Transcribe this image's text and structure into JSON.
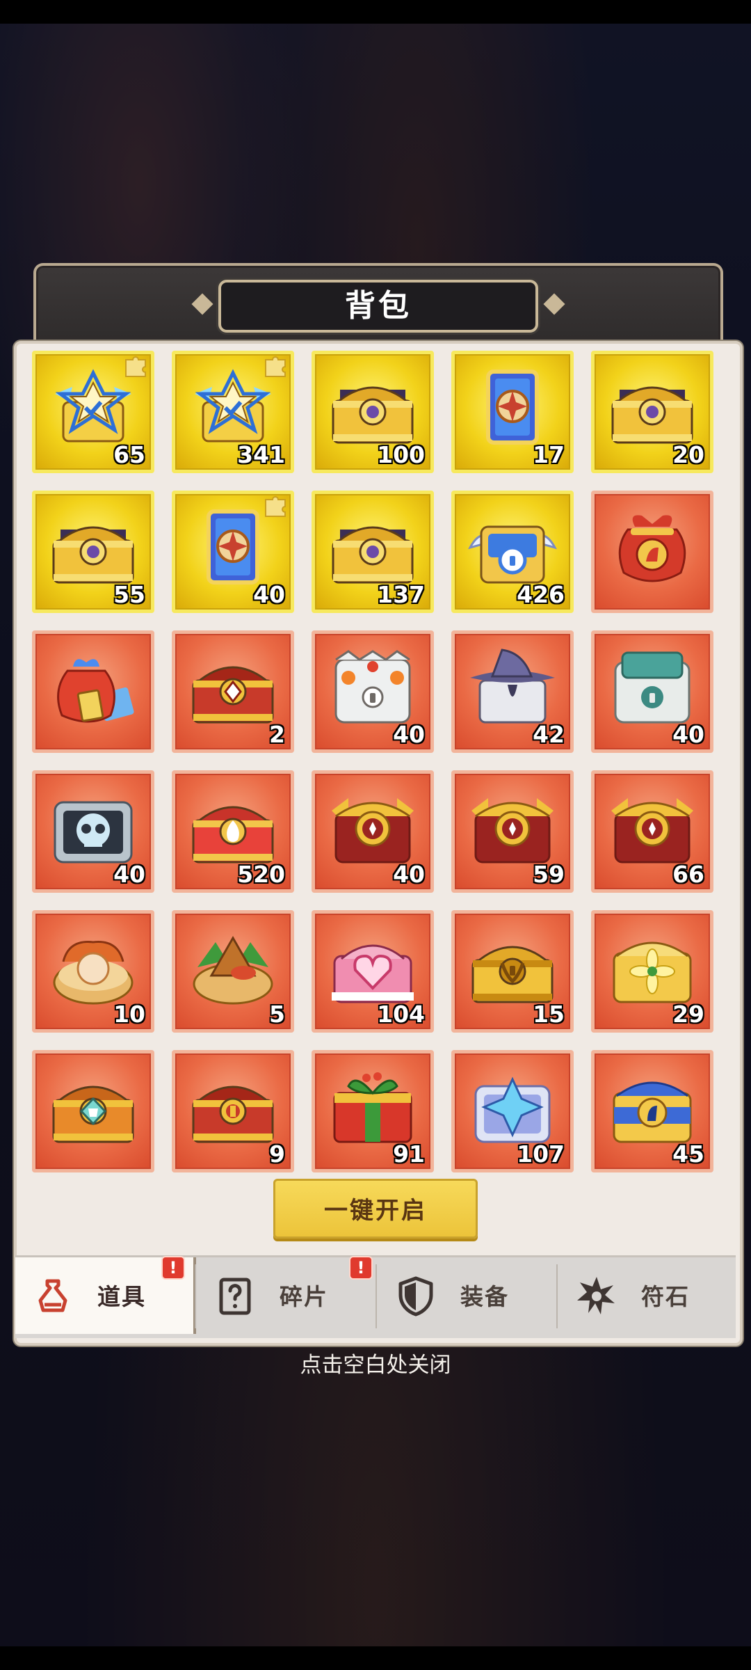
{
  "title": "背包",
  "open_all_button": "一键开启",
  "close_hint": "点击空白处关闭",
  "tabs": [
    {
      "label": "道具",
      "badge": "!",
      "icon": "potion-icon",
      "active": true
    },
    {
      "label": "碎片",
      "badge": "!",
      "icon": "question-card-icon",
      "active": false
    },
    {
      "label": "装备",
      "icon": "shield-icon",
      "active": false
    },
    {
      "label": "符石",
      "icon": "rune-star-icon",
      "active": false
    }
  ],
  "items": [
    {
      "icon": "star-emblem-chest-icon",
      "count": "65",
      "rarity": "gold",
      "fragment": true
    },
    {
      "icon": "star-emblem-chest-icon",
      "count": "341",
      "rarity": "gold",
      "fragment": true
    },
    {
      "icon": "royal-purple-chest-icon",
      "count": "100",
      "rarity": "gold"
    },
    {
      "icon": "hero-card-icon",
      "count": "17",
      "rarity": "gold"
    },
    {
      "icon": "royal-purple-chest-icon",
      "count": "20",
      "rarity": "gold"
    },
    {
      "icon": "royal-purple-chest-icon",
      "count": "55",
      "rarity": "gold"
    },
    {
      "icon": "hero-card-icon",
      "count": "40",
      "rarity": "gold",
      "fragment": true
    },
    {
      "icon": "royal-purple-chest-icon",
      "count": "137",
      "rarity": "gold"
    },
    {
      "icon": "winged-lock-chest-icon",
      "count": "426",
      "rarity": "gold"
    },
    {
      "icon": "red-horse-bag-icon",
      "count": "",
      "rarity": "red"
    },
    {
      "icon": "gift-bag-icon",
      "count": "",
      "rarity": "red"
    },
    {
      "icon": "red-gem-chest-icon",
      "count": "2",
      "rarity": "red"
    },
    {
      "icon": "fire-lock-chest-icon",
      "count": "40",
      "rarity": "red"
    },
    {
      "icon": "witch-hat-chest-icon",
      "count": "42",
      "rarity": "red"
    },
    {
      "icon": "teal-lock-chest-icon",
      "count": "40",
      "rarity": "red"
    },
    {
      "icon": "skull-chest-icon",
      "count": "40",
      "rarity": "red"
    },
    {
      "icon": "flame-crest-chest-icon",
      "count": "520",
      "rarity": "red"
    },
    {
      "icon": "emblem-chest-icon",
      "count": "40",
      "rarity": "red"
    },
    {
      "icon": "emblem-chest-icon",
      "count": "59",
      "rarity": "red"
    },
    {
      "icon": "emblem-chest-icon",
      "count": "66",
      "rarity": "red"
    },
    {
      "icon": "mooncake-basket-icon",
      "count": "10",
      "rarity": "red"
    },
    {
      "icon": "zongzi-basket-icon",
      "count": "5",
      "rarity": "red"
    },
    {
      "icon": "heart-chest-icon",
      "count": "104",
      "rarity": "red"
    },
    {
      "icon": "laurel-gold-chest-icon",
      "count": "15",
      "rarity": "red"
    },
    {
      "icon": "flower-gold-chest-icon",
      "count": "29",
      "rarity": "red"
    },
    {
      "icon": "shirt-crest-chest-icon",
      "count": "",
      "rarity": "red"
    },
    {
      "icon": "coin-crest-chest-icon",
      "count": "9",
      "rarity": "red"
    },
    {
      "icon": "christmas-gift-chest-icon",
      "count": "91",
      "rarity": "red"
    },
    {
      "icon": "ice-crystal-chest-icon",
      "count": "107",
      "rarity": "red"
    },
    {
      "icon": "horse-crest-blue-chest-icon",
      "count": "45",
      "rarity": "red"
    }
  ]
}
